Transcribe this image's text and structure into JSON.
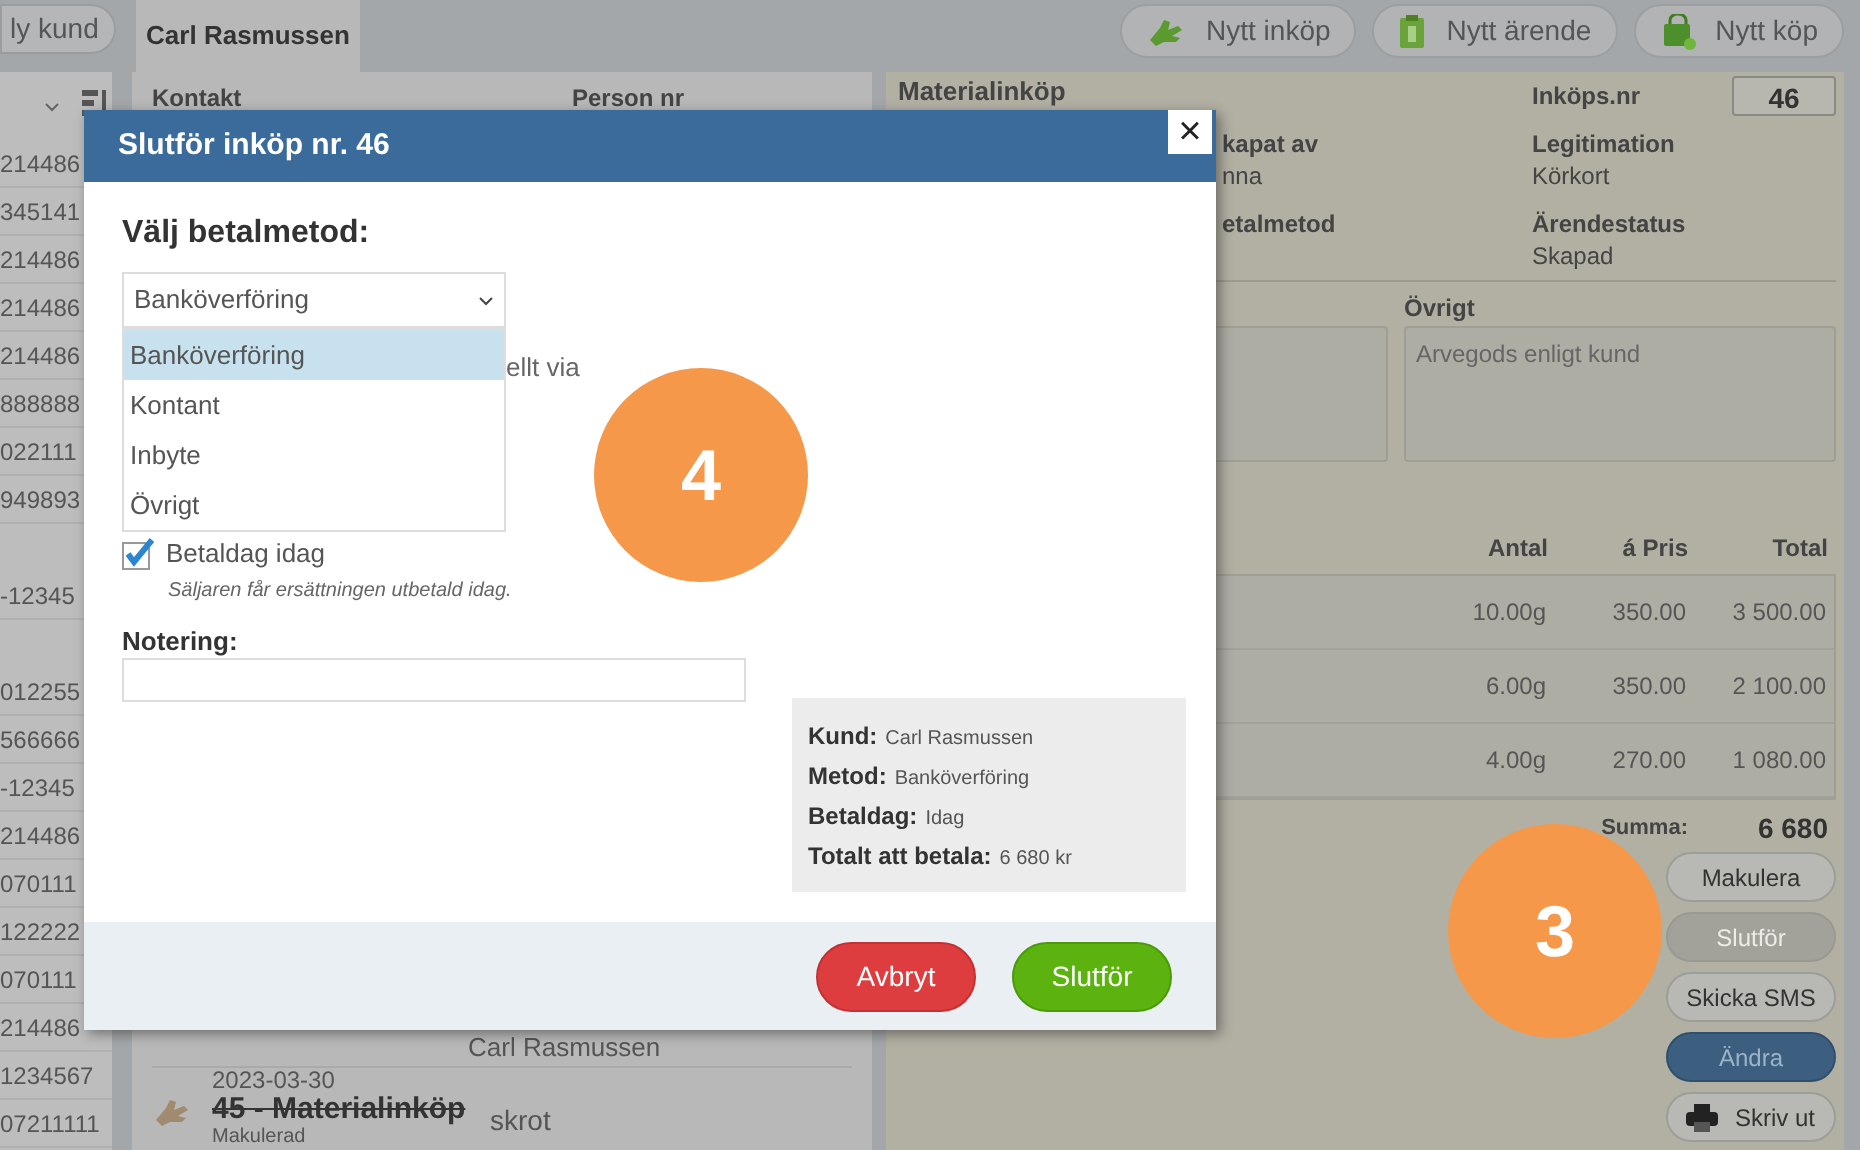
{
  "top_bar": {
    "new_customer_button": "ly kund",
    "tab": {
      "label": "Carl Rasmussen",
      "selected": true
    },
    "actions": [
      {
        "label": "Nytt inköp"
      },
      {
        "label": "Nytt ärende"
      },
      {
        "label": "Nytt köp"
      }
    ]
  },
  "customer_list": {
    "groups": [
      [
        "214486",
        "345141",
        "214486",
        "214486",
        "214486",
        "888888",
        "022111",
        "949893"
      ],
      [
        "-12345"
      ],
      [
        "012255",
        "566666",
        "-12345",
        "214486",
        "070111",
        "122222",
        "070111",
        "214486",
        "1234567",
        "07211111"
      ]
    ]
  },
  "contacts": {
    "columns": [
      "Kontakt",
      "Person nr"
    ],
    "partial_name": "Carl Rasmussen",
    "last_row": {
      "date": "2023-03-30",
      "title": "45 - Materialinköp",
      "note": "skrot",
      "status": "Makulerad",
      "voided": true
    }
  },
  "purchase": {
    "title": "Materialinköp",
    "number_label": "Inköps.nr",
    "number": "46",
    "fields": [
      {
        "label": "kapat av",
        "value": "nna"
      },
      {
        "label": "Legitimation",
        "value": "Körkort"
      },
      {
        "label": "etalmetod"
      },
      {
        "label": "Ärendestatus",
        "value": "Skapad"
      }
    ],
    "other_label": "Övrigt",
    "other_text": "Arvegods enligt kund",
    "table": {
      "columns": [
        "Antal",
        "á Pris",
        "Total"
      ],
      "rows": [
        [
          "10.00g",
          "350.00",
          "3 500.00"
        ],
        [
          "6.00g",
          "350.00",
          "2 100.00"
        ],
        [
          "4.00g",
          "270.00",
          "1 080.00"
        ]
      ]
    },
    "sum_label": "Summa:",
    "sum": "6 680",
    "buttons": [
      {
        "label": "Makulera",
        "kind": "plain"
      },
      {
        "label": "Slutför",
        "kind": "disabled"
      },
      {
        "label": "Skicka SMS",
        "kind": "plain"
      },
      {
        "label": "Ändra",
        "kind": "primary"
      },
      {
        "label": "Skriv ut",
        "kind": "print"
      }
    ]
  },
  "dialog": {
    "title": "Slutför inköp nr. 46",
    "close": "×",
    "heading": "Välj betalmetod:",
    "select": {
      "value": "Banköverföring",
      "expanded": true,
      "options": [
        {
          "label": "Banköverföring",
          "selected": true
        },
        {
          "label": "Kontant",
          "selected": false
        },
        {
          "label": "Inbyte",
          "selected": false
        },
        {
          "label": "Övrigt",
          "selected": false
        }
      ]
    },
    "hidden_text": "ellt via",
    "paid_today": {
      "label": "Betaldag idag",
      "checked": true,
      "hint": "Säljaren får ersättningen utbetald idag."
    },
    "note_label": "Notering:",
    "summary": [
      {
        "label": "Kund:",
        "value": "Carl Rasmussen"
      },
      {
        "label": "Metod:",
        "value": "Banköverföring"
      },
      {
        "label": "Betaldag:",
        "value": "Idag"
      },
      {
        "label": "Totalt att betala:",
        "value": "6 680 kr"
      }
    ],
    "cancel": "Avbryt",
    "confirm": "Slutför"
  },
  "callouts": [
    "4",
    "3"
  ]
}
